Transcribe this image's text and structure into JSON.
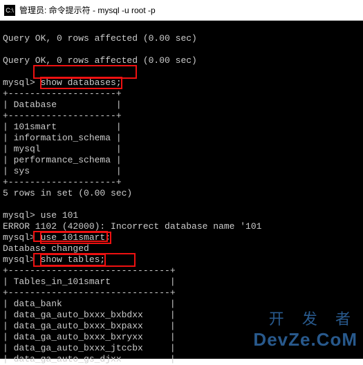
{
  "titlebar": {
    "icon_text": "C:\\",
    "title": "管理员: 命令提示符 - mysql  -u  root  -p"
  },
  "lines": {
    "ok1": "Query OK, 0 rows affected (0.00 sec)",
    "blank": "",
    "ok2": "Query OK, 0 rows affected (0.00 sec)",
    "prompt1_pre": "mysql> ",
    "cmd_show_db": "show databases;",
    "border": "+--------------------+",
    "header_db": "| Database           |",
    "db1": "| 101smart           |",
    "db2": "| information_schema |",
    "db3": "| mysql              |",
    "db4": "| performance_schema |",
    "db5": "| sys                |",
    "rows5": "5 rows in set (0.00 sec)",
    "prompt2": "mysql> use 101",
    "err": "ERROR 1102 (42000): Incorrect database name '101",
    "err_tail": "'",
    "prompt3_pre": "mysql> ",
    "cmd_use_101smart": "use 101smart;",
    "dbchanged": "Database changed",
    "prompt4_pre": "mysql> ",
    "cmd_show_tables": "show tables;",
    "border2": "+------------------------------+",
    "header_tbl": "| Tables_in_101smart           |",
    "t1": "| data_bank                    |",
    "t2": "| data_ga_auto_bxxx_bxbdxx     |",
    "t3": "| data_ga_auto_bxxx_bxpaxx     |",
    "t4": "| data_ga_auto_bxxx_bxryxx     |",
    "t5": "| data_ga_auto_bxxx_jtccbx     |",
    "t6": "| data_ga_auto_gs_djxx         |"
  },
  "watermark": {
    "line1": "开 发 者",
    "line2": "DevZe.CoM"
  }
}
